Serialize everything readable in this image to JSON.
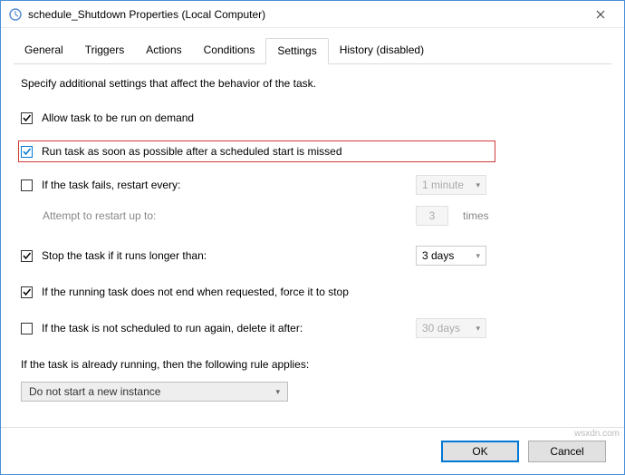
{
  "title": "schedule_Shutdown Properties (Local Computer)",
  "tabs": {
    "general": "General",
    "triggers": "Triggers",
    "actions": "Actions",
    "conditions": "Conditions",
    "settings": "Settings",
    "history": "History (disabled)"
  },
  "settings": {
    "description": "Specify additional settings that affect the behavior of the task.",
    "allow_on_demand": "Allow task to be run on demand",
    "run_asap": "Run task as soon as possible after a scheduled start is missed",
    "fail_restart": "If the task fails, restart every:",
    "fail_restart_interval": "1 minute",
    "attempt_label": "Attempt to restart up to:",
    "attempt_count": "3",
    "attempt_times": "times",
    "stop_longer": "Stop the task if it runs longer than:",
    "stop_longer_value": "3 days",
    "force_stop": "If the running task does not end when requested, force it to stop",
    "delete_after": "If the task is not scheduled to run again, delete it after:",
    "delete_after_value": "30 days",
    "already_running_label": "If the task is already running, then the following rule applies:",
    "already_running_choice": "Do not start a new instance"
  },
  "buttons": {
    "ok": "OK",
    "cancel": "Cancel"
  },
  "watermark": "wsxdn.com"
}
